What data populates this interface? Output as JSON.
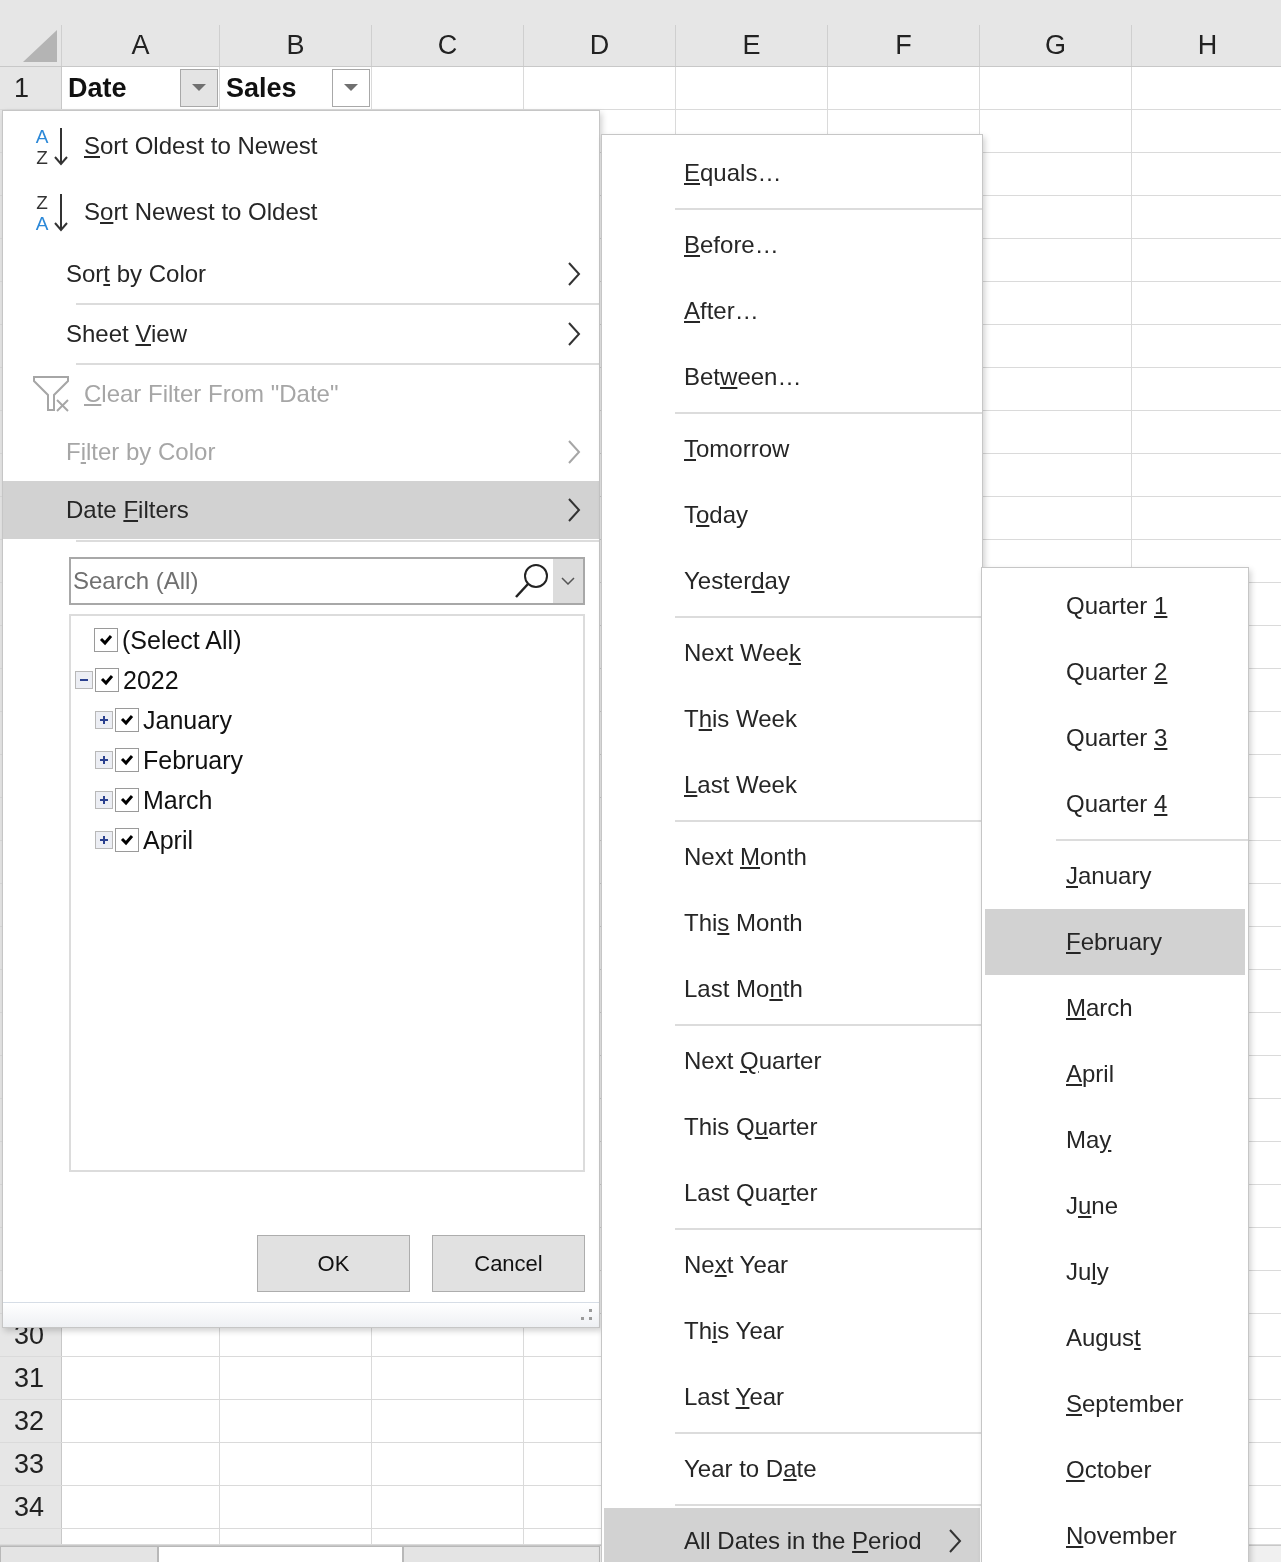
{
  "sheet": {
    "columns": [
      "A",
      "B",
      "C",
      "D",
      "E",
      "F",
      "G",
      "H"
    ],
    "header_cells": [
      {
        "text": "Date",
        "active": true
      },
      {
        "text": "Sales",
        "active": false
      }
    ],
    "row_numbers": [
      "1",
      "30",
      "31",
      "32",
      "33",
      "34"
    ],
    "sheet_tabs": [
      {
        "selected": false
      },
      {
        "selected": true
      },
      {
        "selected": false
      }
    ]
  },
  "filter_menu": {
    "groups": [
      {
        "items": [
          {
            "kind": "sort_ascending",
            "icon_letters": [
              "A",
              "Z"
            ],
            "access_key": "S",
            "text_after": "ort Oldest to Newest",
            "disabled": false,
            "selected": false
          },
          {
            "kind": "sort_descending",
            "icon_letters": [
              "Z",
              "A"
            ],
            "text_before": "S",
            "access_key": "o",
            "text_after": "rt Newest to Oldest",
            "disabled": false,
            "selected": false
          },
          {
            "kind": "submenu",
            "text_before": "Sor",
            "access_key": "t",
            "text_after": " by Color",
            "disabled": false,
            "selected": false
          }
        ]
      },
      {
        "items": [
          {
            "kind": "submenu",
            "text_before": "Sheet ",
            "access_key": "V",
            "text_after": "iew",
            "disabled": false,
            "selected": false
          }
        ]
      },
      {
        "items": [
          {
            "kind": "clear",
            "access_key": "C",
            "text_after": "lear Filter From \"Date\"",
            "disabled": true,
            "selected": false
          },
          {
            "kind": "submenu",
            "text_before": "F",
            "access_key": "i",
            "text_after": "lter by Color",
            "disabled": true,
            "selected": false
          },
          {
            "kind": "submenu",
            "text_before": "Date ",
            "access_key": "F",
            "text_after": "ilters",
            "disabled": false,
            "selected": true
          }
        ]
      }
    ],
    "search": {
      "placeholder": "Search (All)"
    },
    "tree": [
      {
        "label": "(Select All)",
        "checked": true
      },
      {
        "label": "2022",
        "checked": true,
        "expanded": true,
        "children": [
          {
            "label": "January",
            "checked": true,
            "expanded": false
          },
          {
            "label": "February",
            "checked": true,
            "expanded": false
          },
          {
            "label": "March",
            "checked": true,
            "expanded": false
          },
          {
            "label": "April",
            "checked": true,
            "expanded": false
          }
        ]
      }
    ],
    "buttons": [
      "OK",
      "Cancel"
    ]
  },
  "date_filters_menu": {
    "groups": [
      {
        "items": [
          {
            "access_key": "E",
            "text_after": "quals…",
            "selected": false,
            "submenu": false
          }
        ]
      },
      {
        "items": [
          {
            "access_key": "B",
            "text_after": "efore…",
            "selected": false,
            "submenu": false
          },
          {
            "access_key": "A",
            "text_after": "fter…",
            "selected": false,
            "submenu": false
          },
          {
            "text_before": "Bet",
            "access_key": "w",
            "text_after": "een…",
            "selected": false,
            "submenu": false
          }
        ]
      },
      {
        "items": [
          {
            "access_key": "T",
            "text_after": "omorrow",
            "selected": false,
            "submenu": false
          },
          {
            "text_before": "T",
            "access_key": "o",
            "text_after": "day",
            "selected": false,
            "submenu": false
          },
          {
            "text_before": "Yester",
            "access_key": "d",
            "text_after": "ay",
            "selected": false,
            "submenu": false
          }
        ]
      },
      {
        "items": [
          {
            "text_before": "Next Wee",
            "access_key": "k",
            "selected": false,
            "submenu": false
          },
          {
            "text_before": "T",
            "access_key": "h",
            "text_after": "is Week",
            "selected": false,
            "submenu": false
          },
          {
            "access_key": "L",
            "text_after": "ast Week",
            "selected": false,
            "submenu": false
          }
        ]
      },
      {
        "items": [
          {
            "text_before": "Next ",
            "access_key": "M",
            "text_after": "onth",
            "selected": false,
            "submenu": false
          },
          {
            "text_before": "Thi",
            "access_key": "s",
            "text_after": " Month",
            "selected": false,
            "submenu": false
          },
          {
            "text_before": "Last Mo",
            "access_key": "n",
            "text_after": "th",
            "selected": false,
            "submenu": false
          }
        ]
      },
      {
        "items": [
          {
            "text_before": "Next ",
            "access_key": "Q",
            "text_after": "uarter",
            "selected": false,
            "submenu": false
          },
          {
            "text_before": "This Q",
            "access_key": "u",
            "text_after": "arter",
            "selected": false,
            "submenu": false
          },
          {
            "text_before": "Last Qua",
            "access_key": "r",
            "text_after": "ter",
            "selected": false,
            "submenu": false
          }
        ]
      },
      {
        "items": [
          {
            "text_before": "Ne",
            "access_key": "x",
            "text_after": "t Year",
            "selected": false,
            "submenu": false
          },
          {
            "text_before": "Th",
            "access_key": "i",
            "text_after": "s Year",
            "selected": false,
            "submenu": false
          },
          {
            "text_before": "Last ",
            "access_key": "Y",
            "text_after": "ear",
            "selected": false,
            "submenu": false
          }
        ]
      },
      {
        "items": [
          {
            "text_before": "Year to D",
            "access_key": "a",
            "text_after": "te",
            "selected": false,
            "submenu": false
          }
        ]
      },
      {
        "items": [
          {
            "text_before": "All Dates in the ",
            "access_key": "P",
            "text_after": "eriod",
            "selected": true,
            "submenu": true
          }
        ]
      }
    ]
  },
  "period_menu": {
    "groups": [
      {
        "items": [
          {
            "text_before": "Quarter ",
            "access_key": "1",
            "selected": false
          },
          {
            "text_before": "Quarter ",
            "access_key": "2",
            "selected": false
          },
          {
            "text_before": "Quarter ",
            "access_key": "3",
            "selected": false
          },
          {
            "text_before": "Quarter ",
            "access_key": "4",
            "selected": false
          }
        ]
      },
      {
        "items": [
          {
            "access_key": "J",
            "text_after": "anuary",
            "selected": false
          },
          {
            "access_key": "F",
            "text_after": "ebruary",
            "selected": true
          },
          {
            "access_key": "M",
            "text_after": "arch",
            "selected": false
          },
          {
            "access_key": "A",
            "text_after": "pril",
            "selected": false
          },
          {
            "text_before": "Ma",
            "access_key": "y",
            "selected": false
          },
          {
            "text_before": "J",
            "access_key": "u",
            "text_after": "ne",
            "selected": false
          },
          {
            "text_before": "Ju",
            "access_key": "l",
            "text_after": "y",
            "selected": false
          },
          {
            "text_before": "Augus",
            "access_key": "t",
            "selected": false
          },
          {
            "access_key": "S",
            "text_after": "eptember",
            "selected": false
          },
          {
            "access_key": "O",
            "text_after": "ctober",
            "selected": false
          },
          {
            "access_key": "N",
            "text_after": "ovember",
            "selected": false
          }
        ]
      }
    ]
  }
}
